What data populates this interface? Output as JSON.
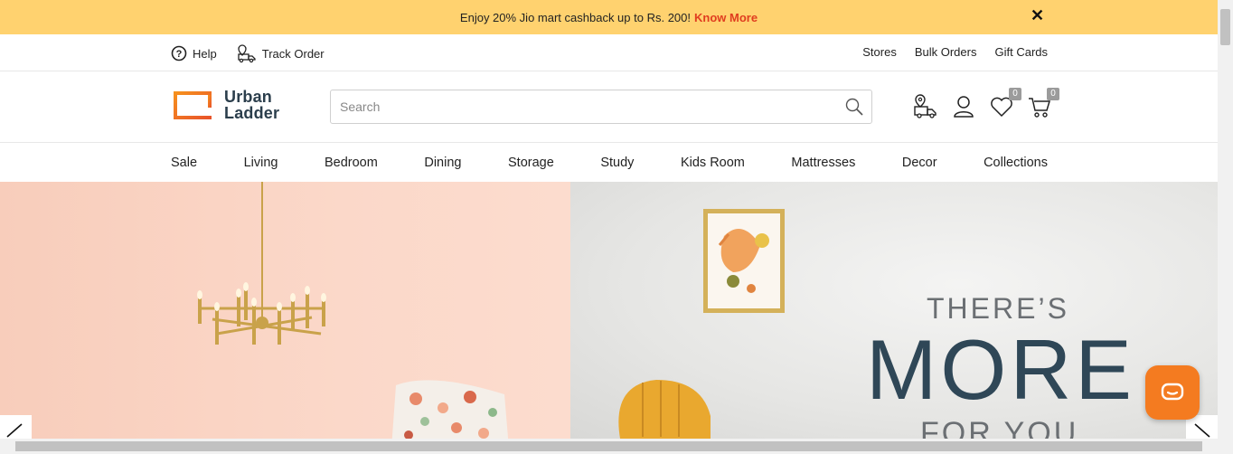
{
  "promo": {
    "text": "Enjoy 20% Jio mart cashback up to Rs. 200!",
    "link": "Know More",
    "close_icon": "close-icon"
  },
  "utility": {
    "help": "Help",
    "track_order": "Track Order",
    "stores": "Stores",
    "bulk_orders": "Bulk Orders",
    "gift_cards": "Gift Cards"
  },
  "header": {
    "logo_line1": "Urban",
    "logo_line2": "Ladder",
    "search_placeholder": "Search",
    "wishlist_count": "0",
    "cart_count": "0"
  },
  "nav": {
    "items": [
      "Sale",
      "Living",
      "Bedroom",
      "Dining",
      "Storage",
      "Study",
      "Kids Room",
      "Mattresses",
      "Decor",
      "Collections"
    ]
  },
  "hero": {
    "line1": "THERE’S",
    "line2": "MORE",
    "line3": "FOR YOU"
  },
  "colors": {
    "promo_bg": "#ffd26f",
    "accent": "#e03d1f",
    "brand_orange": "#f47b20",
    "brand_dark": "#2b3e4c"
  }
}
